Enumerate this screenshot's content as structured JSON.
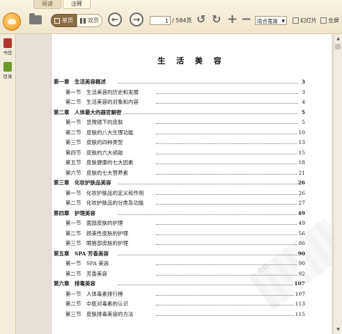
{
  "tabs": [
    "阅读",
    "注释"
  ],
  "active_tab": 1,
  "toolbar": {
    "single_page": "单页",
    "double_page": "双页",
    "page_current": "1",
    "page_total": "/ 584页",
    "zoom": "适合宽度",
    "slideshow": "幻灯片",
    "fullscreen": "全屏"
  },
  "sidebar": {
    "bookmark": "书签",
    "toc": "目录"
  },
  "page": {
    "title": "生 活 美 容",
    "marker_number": "1",
    "watermark": "DG"
  },
  "toc": [
    {
      "type": "ch",
      "label": "第一章　生活美容概述",
      "page": "3"
    },
    {
      "type": "sec",
      "label": "第一节　生活美容的历史和发展",
      "page": "3"
    },
    {
      "type": "sec",
      "label": "第二节　生活美容的对象和内容",
      "page": "4"
    },
    {
      "type": "ch",
      "label": "第二章　人体最大的器官解密",
      "page": "5"
    },
    {
      "type": "sec",
      "label": "第一节　显微镜下的皮肤",
      "page": "5"
    },
    {
      "type": "sec",
      "label": "第二节　皮肤的八大生理功能",
      "page": "10"
    },
    {
      "type": "sec",
      "label": "第三节　皮肤的四种类型",
      "page": "13"
    },
    {
      "type": "sec",
      "label": "第四节　皮肤的六大顽敌",
      "page": "15"
    },
    {
      "type": "sec",
      "label": "第五节　皮肤健康的七大因素",
      "page": "18"
    },
    {
      "type": "sec",
      "label": "第六节　皮肤的七大营养素",
      "page": "21"
    },
    {
      "type": "ch",
      "label": "第三章　化妆护肤品美容",
      "page": "26"
    },
    {
      "type": "sec",
      "label": "第一节　化妆护肤品的定义和作用",
      "page": "26"
    },
    {
      "type": "sec",
      "label": "第二节　化妆护肤品的分类及功能",
      "page": "27"
    },
    {
      "type": "ch",
      "label": "第四章　护理美容",
      "page": "49"
    },
    {
      "type": "sec",
      "label": "第一节　面部皮肤的护理",
      "page": "49"
    },
    {
      "type": "sec",
      "label": "第二节　损美性皮肤的护理",
      "page": "56"
    },
    {
      "type": "sec",
      "label": "第三节　眼唇部皮肤的护理",
      "page": "86"
    },
    {
      "type": "ch",
      "label": "第五章　SPA 芳香美容",
      "page": "90"
    },
    {
      "type": "sec",
      "label": "第一节　SPA 美容",
      "page": "90"
    },
    {
      "type": "sec",
      "label": "第二节　芳香美容",
      "page": "92"
    },
    {
      "type": "ch",
      "label": "第六章　排毒美容",
      "page": "107"
    },
    {
      "type": "sec",
      "label": "第一节　人体毒素排行榜",
      "page": "107"
    },
    {
      "type": "sec",
      "label": "第二节　中医对毒素的认识",
      "page": "113"
    },
    {
      "type": "sec",
      "label": "第三节　皮肤排毒美容的方法",
      "page": "115"
    }
  ]
}
